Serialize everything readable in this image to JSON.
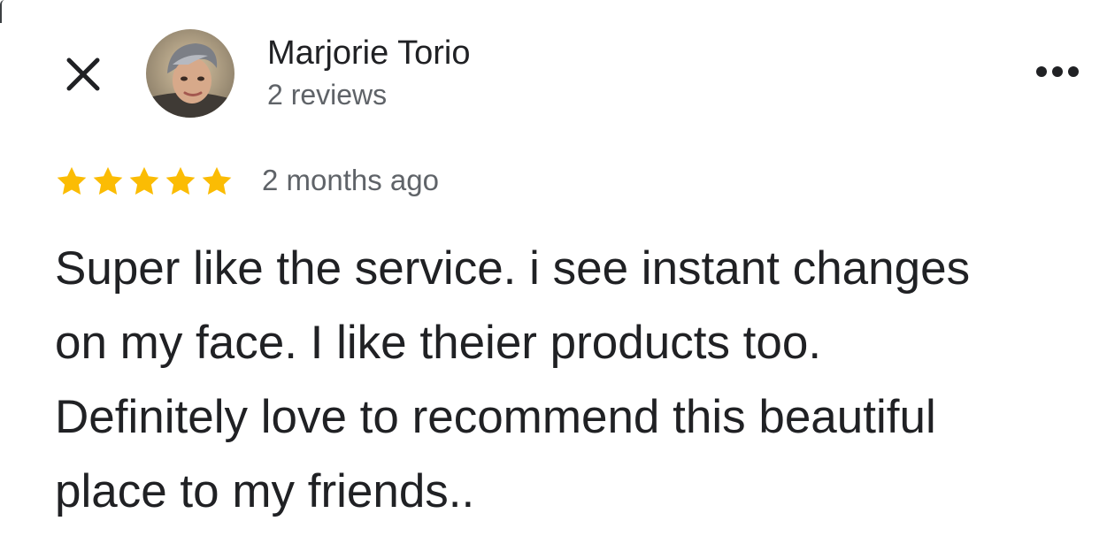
{
  "header": {
    "close_icon": "close-icon",
    "more_icon": "more-horizontal-icon",
    "reviewer": {
      "name": "Marjorie Torio",
      "reviews_count": "2 reviews",
      "avatar": "profile-photo"
    }
  },
  "review": {
    "rating": 5,
    "rating_max": 5,
    "star_color": "#fbbc04",
    "date": "2 months ago",
    "text_lines": [
      "Super like the service. i see instant changes",
      "on my face.  I like theier products too.",
      "Definitely love to recommend this beautiful",
      "place to my friends.."
    ]
  }
}
